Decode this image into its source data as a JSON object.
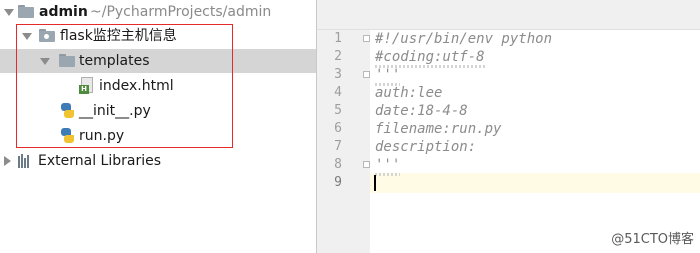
{
  "project": {
    "root_name": "admin",
    "root_path": "~/PycharmProjects/admin",
    "items": [
      {
        "label": "flask监控主机信息",
        "kind": "package-folder",
        "expanded": true
      },
      {
        "label": "templates",
        "kind": "folder",
        "expanded": true,
        "selected": true
      },
      {
        "label": "index.html",
        "kind": "html-file",
        "icon_badge": "H"
      },
      {
        "label": "__init__.py",
        "kind": "python-file"
      },
      {
        "label": "run.py",
        "kind": "python-file"
      }
    ],
    "external_libraries": "External Libraries"
  },
  "editor": {
    "lines": [
      {
        "number": "1",
        "text": "#!/usr/bin/env python"
      },
      {
        "number": "2",
        "text": "#coding:utf-8"
      },
      {
        "number": "3",
        "text": "'''"
      },
      {
        "number": "4",
        "text": "auth:lee"
      },
      {
        "number": "5",
        "text": "date:18-4-8"
      },
      {
        "number": "6",
        "text": "filename:run.py"
      },
      {
        "number": "7",
        "text": "description:"
      },
      {
        "number": "8",
        "text": "'''"
      },
      {
        "number": "9",
        "text": ""
      }
    ],
    "current_line": "9"
  },
  "watermark": "@51CTO博客",
  "colors": {
    "selection": "#d5d5d5",
    "highlight_box": "#e52a2a",
    "comment_text": "#8c8c8c",
    "current_line_bg": "#fffbe5"
  },
  "icons": {
    "root": "folder-icon",
    "package": "package-folder-icon",
    "templates": "folder-icon",
    "html": "html-file-icon",
    "python": "python-file-icon",
    "libraries": "external-libraries-icon"
  }
}
